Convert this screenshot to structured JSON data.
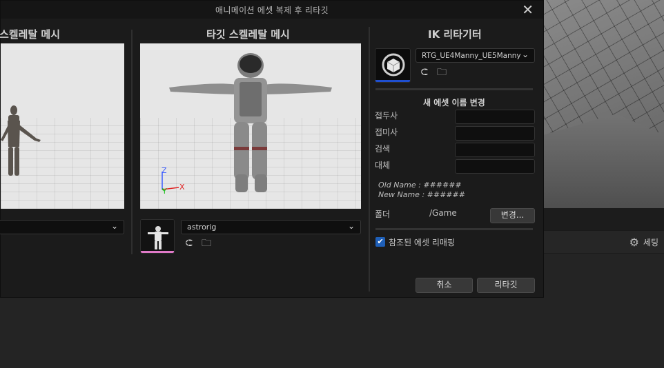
{
  "dialog": {
    "title": "애니메이션 에셋 복제 후 리타깃"
  },
  "source_panel": {
    "title": "스켈레탈 메시"
  },
  "target_panel": {
    "title": "타깃 스켈레탈 메시",
    "mesh_selected": "astrorig",
    "axis_labels": {
      "z": "Z",
      "x": "X",
      "y": "Y"
    }
  },
  "ik_panel": {
    "title": "IK 리타기터",
    "retargeter_selected": "RTG_UE4Manny_UE5Manny",
    "rename_section_title": "새 에셋 이름 변경",
    "prefix_label": "접두사",
    "suffix_label": "접미사",
    "search_label": "검색",
    "replace_label": "대체",
    "old_name_note": "Old Name : ######",
    "new_name_note": "New Name : ######",
    "folder_label": "폴더",
    "folder_path": "/Game",
    "change_button": "변경...",
    "remap_checkbox_label": "참조된 에셋 리매핑",
    "remap_checked": true,
    "cancel_button": "취소",
    "retarget_button": "리타깃"
  },
  "background": {
    "settings_label": "세팅"
  },
  "colors": {
    "accent_blue": "#1e5fb8",
    "thumb_pink": "#e07ac8",
    "thumb_blue": "#1f4fd0",
    "axis_z": "#3a5cff",
    "axis_x": "#e02020",
    "axis_y": "#20c020"
  },
  "icons": [
    "close-icon",
    "chevron-down-icon",
    "back-arrow-icon",
    "browse-icon",
    "gear-icon",
    "check-icon",
    "cube-icon"
  ]
}
